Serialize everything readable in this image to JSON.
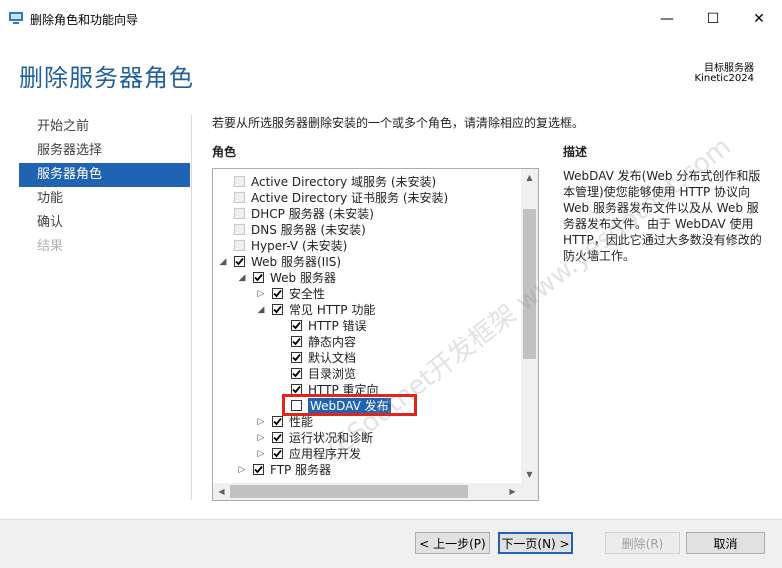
{
  "window": {
    "title": "删除角色和功能向导",
    "minimize": "—",
    "maximize": "☐",
    "close": "✕"
  },
  "page": {
    "title": "删除服务器角色",
    "dest_label": "目标服务器",
    "dest_value": "Kinetic2024"
  },
  "nav": [
    {
      "label": "开始之前",
      "state": "normal"
    },
    {
      "label": "服务器选择",
      "state": "normal"
    },
    {
      "label": "服务器角色",
      "state": "active"
    },
    {
      "label": "功能",
      "state": "normal"
    },
    {
      "label": "确认",
      "state": "normal"
    },
    {
      "label": "结果",
      "state": "disabled"
    }
  ],
  "instruction": "若要从所选服务器删除安装的一个或多个角色，请清除相应的复选框。",
  "roles_header": "角色",
  "description": {
    "header": "描述",
    "text": "WebDAV 发布(Web 分布式创作和版本管理)使您能够使用 HTTP 协议向 Web 服务器发布文件以及从 Web 服务器发布文件。由于 WebDAV 使用 HTTP，因此它通过大多数没有修改的防火墙工作。"
  },
  "tree": [
    {
      "label": "Active Directory 域服务 (未安装)",
      "level": 1,
      "expander": "",
      "checked": false,
      "disabled": true
    },
    {
      "label": "Active Directory 证书服务 (未安装)",
      "level": 1,
      "expander": "",
      "checked": false,
      "disabled": true
    },
    {
      "label": "DHCP 服务器 (未安装)",
      "level": 1,
      "expander": "",
      "checked": false,
      "disabled": true
    },
    {
      "label": "DNS 服务器 (未安装)",
      "level": 1,
      "expander": "",
      "checked": false,
      "disabled": true
    },
    {
      "label": "Hyper-V (未安装)",
      "level": 1,
      "expander": "",
      "checked": false,
      "disabled": true
    },
    {
      "label": "Web 服务器(IIS)",
      "level": 1,
      "expander": "◢",
      "checked": true,
      "disabled": false
    },
    {
      "label": "Web 服务器",
      "level": 2,
      "expander": "◢",
      "checked": true,
      "disabled": false
    },
    {
      "label": "安全性",
      "level": 3,
      "expander": "▷",
      "checked": true,
      "disabled": false
    },
    {
      "label": "常见 HTTP 功能",
      "level": 3,
      "expander": "◢",
      "checked": true,
      "disabled": false
    },
    {
      "label": "HTTP 错误",
      "level": 4,
      "expander": "",
      "checked": true,
      "disabled": false
    },
    {
      "label": "静态内容",
      "level": 4,
      "expander": "",
      "checked": true,
      "disabled": false
    },
    {
      "label": "默认文档",
      "level": 4,
      "expander": "",
      "checked": true,
      "disabled": false
    },
    {
      "label": "目录浏览",
      "level": 4,
      "expander": "",
      "checked": true,
      "disabled": false
    },
    {
      "label": "HTTP 重定向",
      "level": 4,
      "expander": "",
      "checked": true,
      "disabled": false
    },
    {
      "label": "WebDAV 发布",
      "level": 4,
      "expander": "",
      "checked": false,
      "disabled": false,
      "selected": true
    },
    {
      "label": "性能",
      "level": 3,
      "expander": "▷",
      "checked": true,
      "disabled": false
    },
    {
      "label": "运行状况和诊断",
      "level": 3,
      "expander": "▷",
      "checked": true,
      "disabled": false
    },
    {
      "label": "应用程序开发",
      "level": 3,
      "expander": "▷",
      "checked": true,
      "disabled": false
    },
    {
      "label": "FTP 服务器",
      "level": 2,
      "expander": "▷",
      "checked": true,
      "disabled": false
    }
  ],
  "scroll": {
    "up": "▲",
    "down": "▼",
    "left": "◀",
    "right": "▶"
  },
  "watermark": "YESdotnet开发框架 www.yesdotnet.com",
  "buttons": {
    "prev": "< 上一步(P)",
    "next": "下一页(N) >",
    "remove": "删除(R)",
    "cancel": "取消"
  },
  "colors": {
    "accent": "#1f63b2",
    "title": "#1f5f9c",
    "highlight": "#e0261c"
  }
}
